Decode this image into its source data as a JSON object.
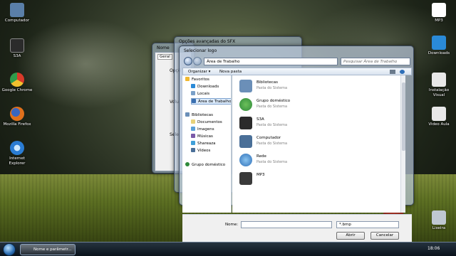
{
  "desktop": {
    "icons_left": [
      {
        "label": "Computador",
        "color": "#5a7fa8"
      },
      {
        "label": "S3A",
        "color": "#2b2b2b"
      },
      {
        "label": "Google Chrome",
        "color": "#d93a2a"
      },
      {
        "label": "Mozilla Firefox",
        "color": "#e0701c"
      },
      {
        "label": "Internet Explorer",
        "color": "#2a7cd3"
      }
    ],
    "icons_right": [
      {
        "label": "MP3",
        "color": "#ffffff"
      },
      {
        "label": "Downloads",
        "color": "#2a8ad8"
      },
      {
        "label": "Instalação Visual",
        "color": "#e8e8e8"
      },
      {
        "label": "Video Aula",
        "color": "#e8e8e8"
      },
      {
        "label": "Lixeira",
        "color": "#bfc8d2"
      }
    ]
  },
  "back_window": {
    "title": "Nome",
    "tab": "Geral",
    "labels": [
      "Opçõ",
      "Volu",
      "Sele"
    ]
  },
  "options_window": {
    "title": "Opções avançadas do SFX"
  },
  "dialog": {
    "title": "Selecionar logo",
    "address": "Área de Trabalho",
    "search_placeholder": "Pesquisar Área de Trabalho",
    "toolbar": {
      "organize": "Organizar ▾",
      "new_folder": "Nova pasta"
    },
    "nav": {
      "favorites": "Favoritos",
      "downloads": "Downloads",
      "locais": "Locais",
      "desktop": "Área de Trabalho",
      "libraries": "Bibliotecas",
      "documentos": "Documentos",
      "imagens": "Imagens",
      "musicas": "Músicas",
      "shareaza": "Shareaza",
      "videos": "Vídeos",
      "homegroup": "Grupo doméstico"
    },
    "items": [
      {
        "name": "Bibliotecas",
        "sub": "Pasta do Sistema",
        "color": "#6b8fb8"
      },
      {
        "name": "Grupo doméstico",
        "sub": "Pasta do Sistema",
        "color": "#2f8a3a"
      },
      {
        "name": "S3A",
        "sub": "Pasta do Sistema",
        "color": "#2b2b2b"
      },
      {
        "name": "Computador",
        "sub": "Pasta do Sistema",
        "color": "#4a6f98"
      },
      {
        "name": "Rede",
        "sub": "Pasta do Sistema",
        "color": "#2e6fb8"
      },
      {
        "name": "MP3",
        "sub": "",
        "color": "#3a3a3a"
      }
    ],
    "filename_label": "Nome:",
    "filename_value": "",
    "filetype_value": "*.bmp",
    "open_button": "Abrir",
    "cancel_button": "Cancelar"
  },
  "taskbar": {
    "task_label": "Nome e parâmetr...",
    "clock": "18:06"
  }
}
